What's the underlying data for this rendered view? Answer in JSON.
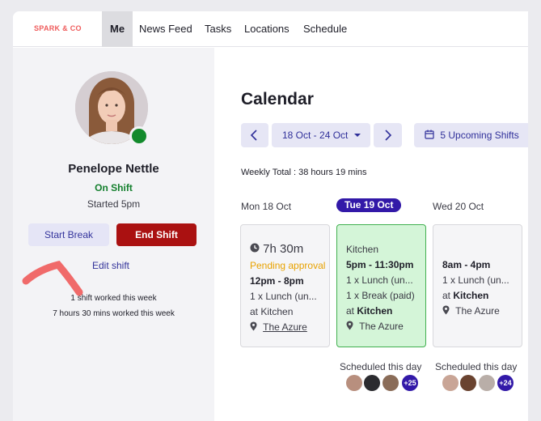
{
  "nav": {
    "brand": "SPARK & CO",
    "items": [
      "Me",
      "News Feed",
      "Tasks",
      "Locations",
      "Schedule"
    ]
  },
  "profile": {
    "name": "Penelope Nettle",
    "status": "On Shift",
    "started": "Started 5pm",
    "start_break": "Start Break",
    "end_shift": "End Shift",
    "edit_shift": "Edit shift",
    "shifts_worked": "1 shift worked this week",
    "hours_worked": "7 hours 30 mins worked this week"
  },
  "calendar": {
    "title": "Calendar",
    "range": "18 Oct - 24 Oct",
    "upcoming": "5 Upcoming Shifts",
    "weekly_total": "Weekly Total : 38 hours 19 mins",
    "days": [
      {
        "header": "Mon 18 Oct",
        "duration": "7h 30m",
        "pending": "Pending approval",
        "time": "12pm - 8pm",
        "line1": "1 x Lunch (un...",
        "at": "at Kitchen",
        "location": "The Azure"
      },
      {
        "header": "Tue 19 Oct",
        "area": "Kitchen",
        "time": "5pm - 11:30pm",
        "line1": "1 x Lunch (un...",
        "line2": "1 x Break (paid)",
        "at_prefix": "at",
        "at_place": "Kitchen",
        "location": "The Azure",
        "scheduled": "Scheduled this day",
        "more": "+25"
      },
      {
        "header": "Wed 20 Oct",
        "time": "8am - 4pm",
        "line1": "1 x Lunch (un...",
        "at_prefix": "at",
        "at_place": "Kitchen",
        "location": "The Azure",
        "scheduled": "Scheduled this day",
        "more": "+24"
      }
    ]
  },
  "colors": {
    "accent": "#3219a8",
    "danger": "#aa1111",
    "success": "#137f2d",
    "pending": "#e8a200"
  }
}
